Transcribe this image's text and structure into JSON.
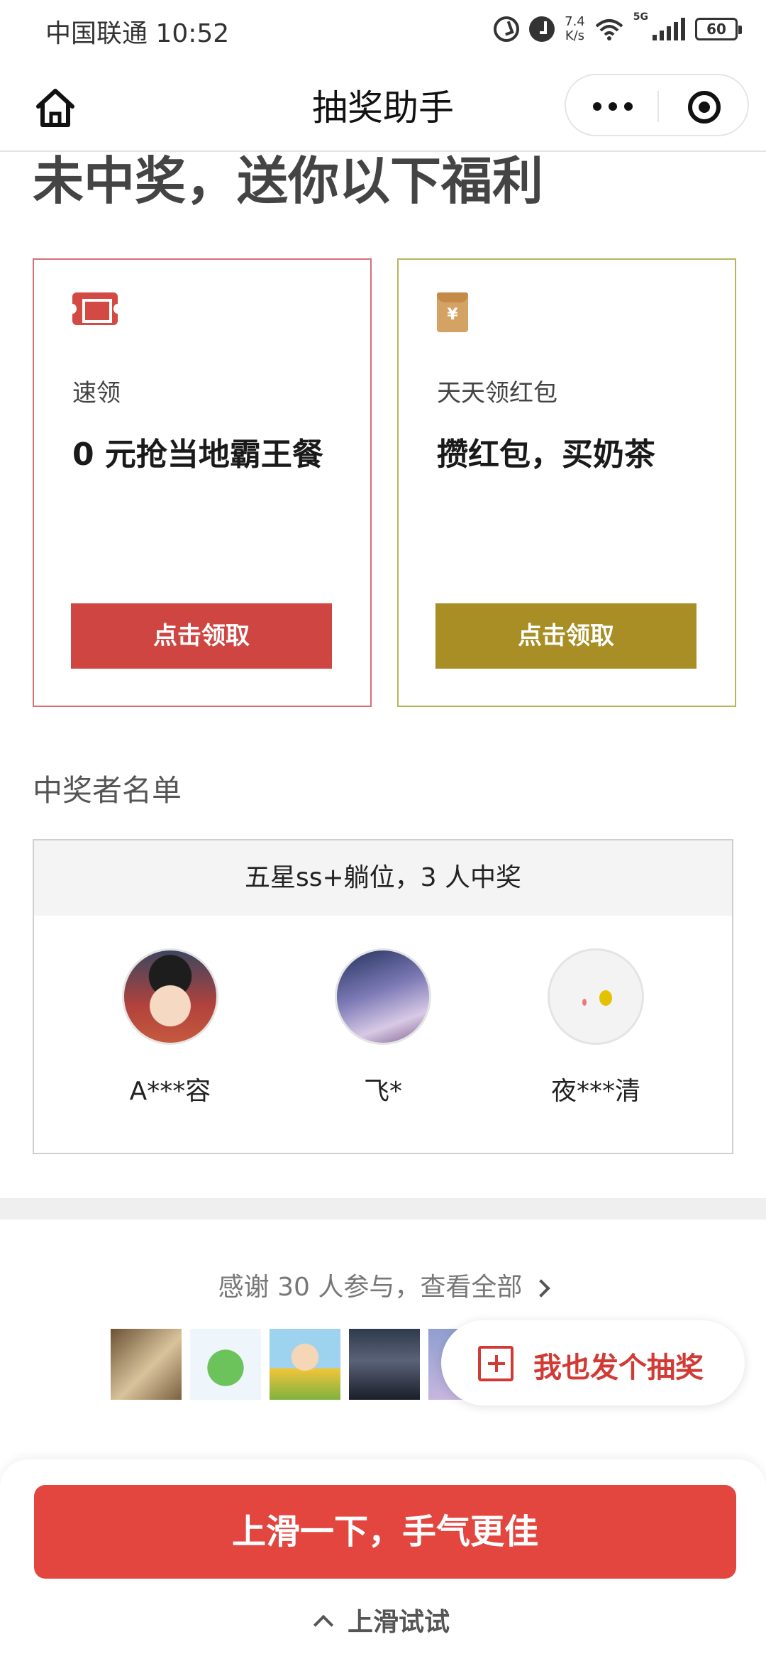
{
  "status_bar": {
    "carrier_time": "中国联通 10:52",
    "net_speed": "7.4",
    "net_speed_unit": "K/s",
    "network": "5G",
    "battery": "60"
  },
  "nav": {
    "title": "抽奖助手"
  },
  "heading_partial": "未中奖，送你以下福利",
  "cards": [
    {
      "icon": "ticket-icon",
      "subtitle": "速领",
      "title": "0 元抢当地霸王餐",
      "button": "点击领取",
      "color": "#cf4541"
    },
    {
      "icon": "red-envelope-icon",
      "subtitle": "天天领红包",
      "title": "攒红包，买奶茶",
      "button": "点击领取",
      "color": "#a88e25"
    }
  ],
  "winners": {
    "title": "中奖者名单",
    "prize": "五星ss+躺位，3 人中奖",
    "list": [
      {
        "name": "A***容"
      },
      {
        "name": "飞*"
      },
      {
        "name": "夜***清"
      }
    ]
  },
  "participants": {
    "thanks": "感谢 30 人参与，查看全部"
  },
  "float_button": {
    "label": "我也发个抽奖"
  },
  "bottom": {
    "cta": "上滑一下，手气更佳",
    "hint": "上滑试试"
  }
}
